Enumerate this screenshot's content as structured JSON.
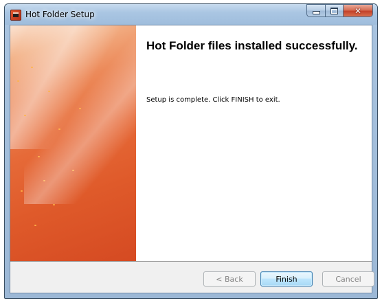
{
  "window": {
    "title": "Hot Folder Setup",
    "icon": "app-icon",
    "caption_buttons": {
      "minimize": "minimize-icon",
      "maximize": "maximize-icon",
      "close": "close-icon"
    }
  },
  "main": {
    "heading": "Hot Folder files installed successfully.",
    "message": "Setup is complete. Click FINISH to exit."
  },
  "buttons": {
    "back": {
      "label": "< Back",
      "enabled": false
    },
    "finish": {
      "label": "Finish",
      "enabled": true,
      "default": true
    },
    "cancel": {
      "label": "Cancel",
      "enabled": false
    }
  },
  "colors": {
    "side_panel_accent": "#e2552b",
    "button_bar": "#f0f0f0"
  }
}
